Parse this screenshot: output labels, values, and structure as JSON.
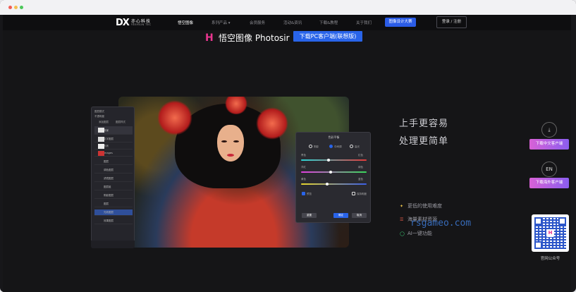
{
  "nav": {
    "logo_mark": "DX",
    "logo_cn": "亦心科技",
    "logo_en": "YEEHSIN TEC",
    "items": [
      {
        "label": "悟空图像",
        "active": true
      },
      {
        "label": "系列产品 ▾"
      },
      {
        "label": "会员服务"
      },
      {
        "label": "活动&资讯"
      },
      {
        "label": "下载&教程"
      },
      {
        "label": "关于我们"
      }
    ],
    "highlight_label": "图像设计大赛",
    "login_label": "登录 / 注册"
  },
  "product": {
    "icon": "H",
    "name": "悟空图像  Photosir",
    "download_label": "下载PC客户端(联想版)"
  },
  "ps_panel": {
    "header1": "图层模式",
    "header2": "不透明度",
    "btn1": "添加图层",
    "btn2": "图层样式",
    "layers": [
      "背景",
      "文字图层",
      "形状",
      "Images",
      "图层",
      "调色图层",
      "滤镜图层",
      "图层组",
      "阴影图层",
      "图层",
      "光效图层",
      "效果图层"
    ]
  },
  "color_panel": {
    "title": "色彩平衡",
    "modes": [
      "阴影",
      "中间调",
      "高光"
    ],
    "sliders": [
      {
        "left": "青色",
        "right": "红色",
        "value": 0.42
      },
      {
        "left": "洋红",
        "right": "绿色",
        "value": 0.45
      },
      {
        "left": "黄色",
        "right": "蓝色",
        "value": 0.4
      }
    ],
    "check1": "预览",
    "check2": "保持明度",
    "buttons": [
      "重置",
      "确定",
      "取消"
    ]
  },
  "tagline": [
    "上手更容易",
    "处理更简单"
  ],
  "features": [
    {
      "icon": "bulb-icon",
      "text": "更低的使用难度"
    },
    {
      "icon": "layers-icon",
      "text": "海量素材资源"
    },
    {
      "icon": "ring-icon",
      "text": "AI一键功能"
    }
  ],
  "watermark": "rsgameo.com",
  "side": {
    "download_cn_label": "下载中文客户端",
    "en_label": "EN",
    "download_en_label": "下载海外客户端",
    "qr_logo": "H",
    "qr_caption": "官网公众号"
  },
  "colors": {
    "accent": "#2964e9",
    "brand_pink": "#e9358f",
    "bg": "#151517"
  }
}
